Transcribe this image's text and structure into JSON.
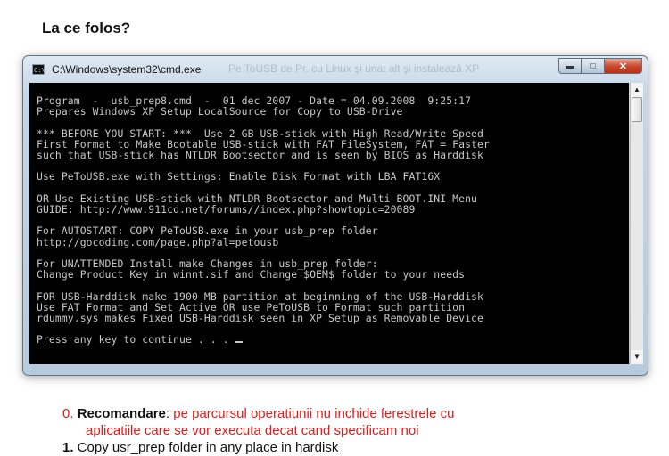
{
  "heading": "La ce folos?",
  "window": {
    "title": "C:\\Windows\\system32\\cmd.exe",
    "ghost_title": "Pe ToUSB de Pr. cu Linux şi unat alt şi instalează XP",
    "console_lines": [
      "Program  -  usb_prep8.cmd  -  01 dec 2007 - Date = 04.09.2008  9:25:17",
      "Prepares Windows XP Setup LocalSource for Copy to USB-Drive",
      "",
      "*** BEFORE YOU START: ***  Use 2 GB USB-stick with High Read/Write Speed",
      "First Format to Make Bootable USB-stick with FAT FileSystem, FAT = Faster",
      "such that USB-stick has NTLDR Bootsector and is seen by BIOS as Harddisk",
      "",
      "Use PeToUSB.exe with Settings: Enable Disk Format with LBA FAT16X",
      "",
      "OR Use Existing USB-stick with NTLDR Bootsector and Multi BOOT.INI Menu",
      "GUIDE: http://www.911cd.net/forums//index.php?showtopic=20089",
      "",
      "For AUTOSTART: COPY PeToUSB.exe in your usb_prep folder",
      "http://gocoding.com/page.php?al=petousb",
      "",
      "For UNATTENDED Install make Changes in usb_prep folder:",
      "Change Product Key in winnt.sif and Change $OEM$ folder to your needs",
      "",
      "FOR USB-Harddisk make 1900 MB partition at beginning of the USB-Harddisk",
      "Use FAT Format and Set Active OR use PeToUSB to Format such partition",
      "rdummy.sys makes Fixed USB-Harddisk seen in XP Setup as Removable Device",
      ""
    ],
    "prompt": "Press any key to continue . . . ",
    "colors": {
      "console_bg": "#000000",
      "console_fg": "#c8c8c8",
      "close": "#c7442a"
    }
  },
  "list": {
    "item0": {
      "number": "0.",
      "bold": "Recomandare",
      "colon": ":",
      "text": " pe parcursul operatiunii nu inchide ferestrele cu",
      "continuation": "aplicatiile care se vor executa decat cand specificam noi"
    },
    "item1": {
      "number": "1.",
      "text": " Copy usr_prep folder in any place in hardisk"
    }
  }
}
